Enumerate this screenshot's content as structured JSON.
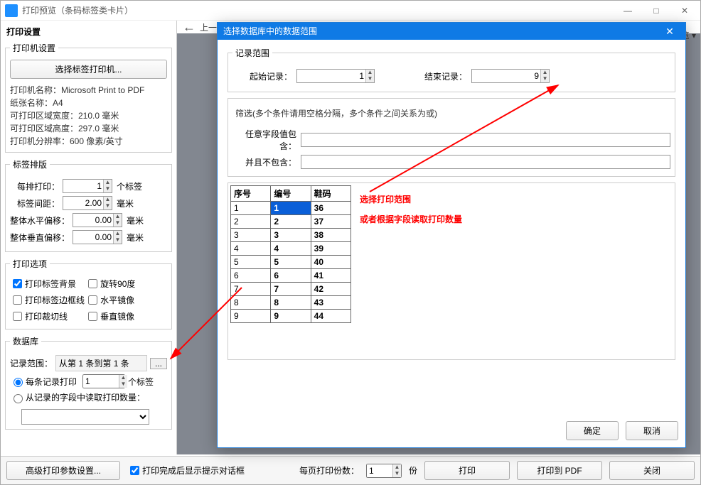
{
  "window": {
    "title": "打印预览（条码标签类卡片）",
    "min": "—",
    "max": "□",
    "close": "✕"
  },
  "left": {
    "heading": "打印设置",
    "printer": {
      "legend": "打印机设置",
      "select_btn": "选择标签打印机...",
      "name_lbl": "打印机名称：Microsoft Print to PDF",
      "paper_lbl": "纸张名称：A4",
      "w_lbl": "可打印区域宽度：210.0 毫米",
      "h_lbl": "可打印区域高度：297.0 毫米",
      "res_lbl": "打印机分辨率：600 像素/英寸"
    },
    "layout": {
      "legend": "标签排版",
      "per_row_lbl": "每排打印：",
      "per_row_val": "1",
      "per_row_unit": "个标签",
      "gap_lbl": "标签间距：",
      "gap_val": "2.00",
      "gap_unit": "毫米",
      "hoff_lbl": "整体水平偏移：",
      "hoff_val": "0.00",
      "hoff_unit": "毫米",
      "voff_lbl": "整体垂直偏移：",
      "voff_val": "0.00",
      "voff_unit": "毫米"
    },
    "options": {
      "legend": "打印选项",
      "bg": "打印标签背景",
      "rotate": "旋转90度",
      "border": "打印标签边框线",
      "hmirror": "水平镜像",
      "cut": "打印裁切线",
      "vmirror": "垂直镜像"
    },
    "db": {
      "legend": "数据库",
      "range_lbl": "记录范围：",
      "range_val": "从第 1 条到第 1 条",
      "r1": "每条记录打印",
      "r1_val": "1",
      "r1_unit": "个标签",
      "r2": "从记录的字段中读取打印数量："
    }
  },
  "nav": {
    "back": "上一"
  },
  "view_peek": "览 ▾",
  "bottom": {
    "adv": "高级打印参数设置...",
    "done_hint": "打印完成后显示提示对话框",
    "copies_lbl": "每页打印份数：",
    "copies_val": "1",
    "copies_unit": "份",
    "print": "打印",
    "pdf": "打印到 PDF",
    "close": "关闭"
  },
  "modal": {
    "title": "选择数据库中的数据范围",
    "close": "✕",
    "range_legend": "记录范围",
    "start_lbl": "起始记录：",
    "start_val": "1",
    "end_lbl": "结束记录：",
    "end_val": "9",
    "filter_legend": "",
    "filter_hint": "筛选(多个条件请用空格分隔，多个条件之间关系为或)",
    "f1_lbl": "任意字段值包含：",
    "f2_lbl": "并且不包含：",
    "headers": [
      "序号",
      "编号",
      "鞋码"
    ],
    "rows": [
      [
        "1",
        "1",
        "36"
      ],
      [
        "2",
        "2",
        "37"
      ],
      [
        "3",
        "3",
        "38"
      ],
      [
        "4",
        "4",
        "39"
      ],
      [
        "5",
        "5",
        "40"
      ],
      [
        "6",
        "6",
        "41"
      ],
      [
        "7",
        "7",
        "42"
      ],
      [
        "8",
        "8",
        "43"
      ],
      [
        "9",
        "9",
        "44"
      ]
    ],
    "annot1": "选择打印范围",
    "annot2": "或者根据字段读取打印数量",
    "ok": "确定",
    "cancel": "取消"
  },
  "chart_data": {
    "type": "table",
    "columns": [
      "序号",
      "编号",
      "鞋码"
    ],
    "rows": [
      [
        1,
        1,
        36
      ],
      [
        2,
        2,
        37
      ],
      [
        3,
        3,
        38
      ],
      [
        4,
        4,
        39
      ],
      [
        5,
        5,
        40
      ],
      [
        6,
        6,
        41
      ],
      [
        7,
        7,
        42
      ],
      [
        8,
        8,
        43
      ],
      [
        9,
        9,
        44
      ]
    ]
  }
}
